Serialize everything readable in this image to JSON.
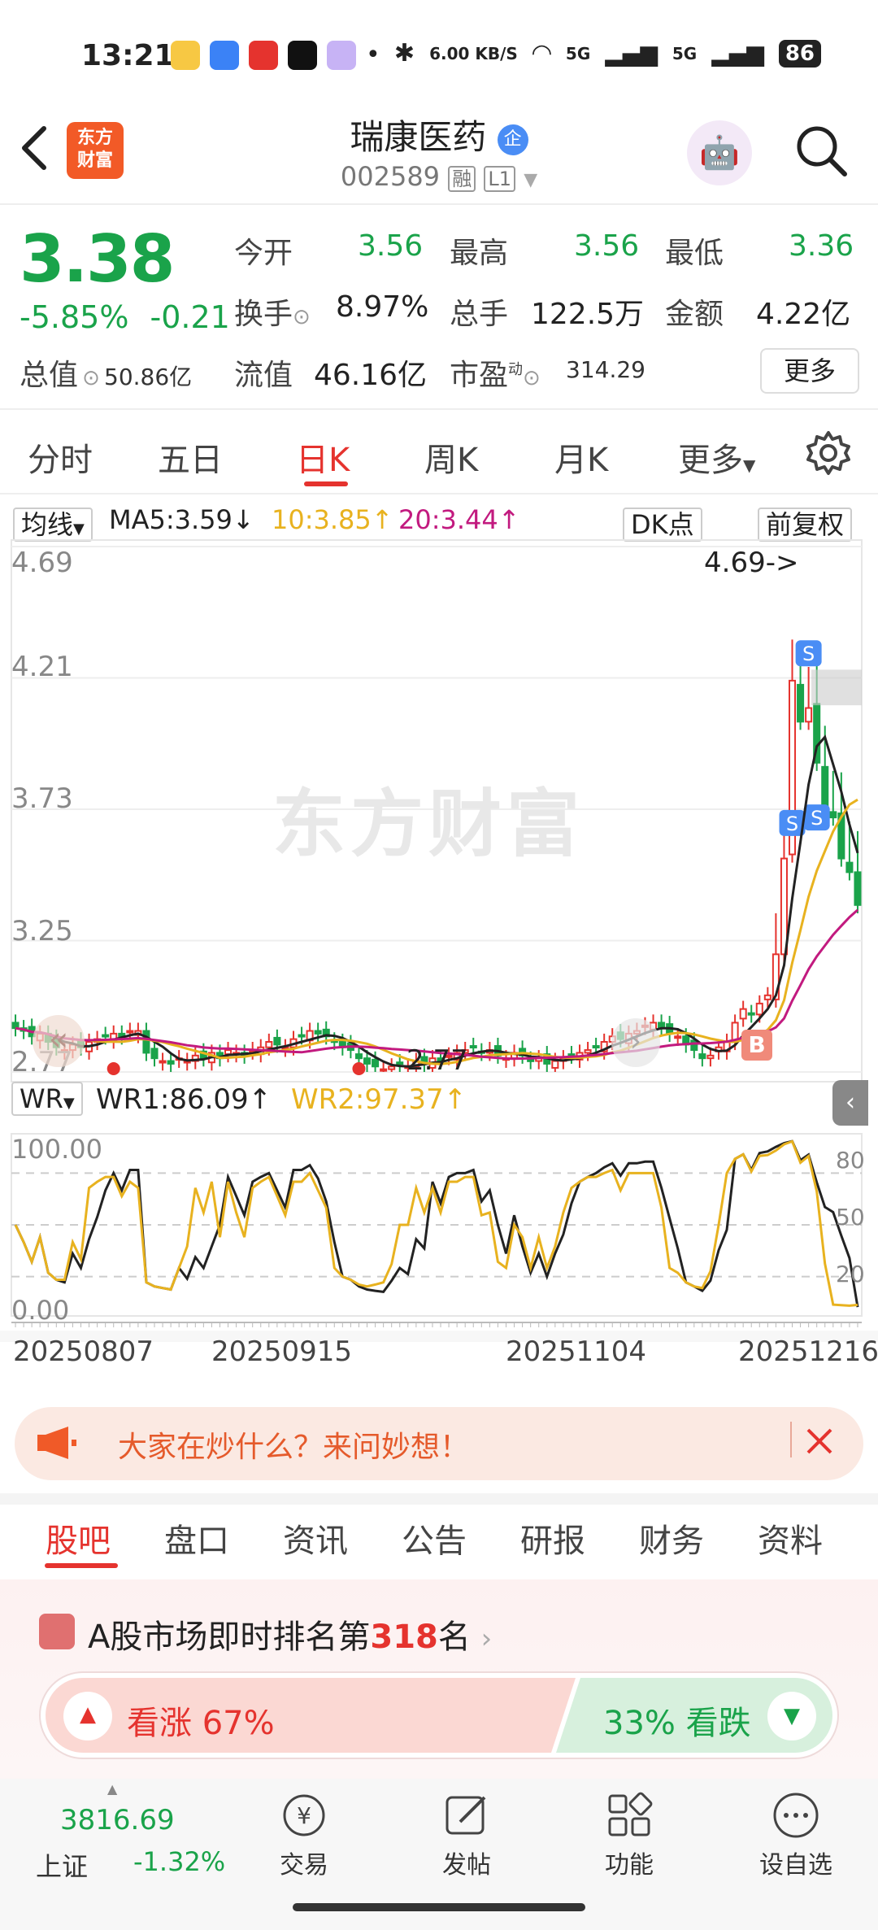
{
  "status_bar": {
    "time": "13:21",
    "speed": "6.00 KB/S",
    "battery": "86",
    "signal1": "5G",
    "signal2": "5G"
  },
  "header": {
    "logo_text_line1": "东方",
    "logo_text_line2": "财富",
    "stock_name": "瑞康医药",
    "stock_badge": "企",
    "stock_code": "002589",
    "tag_rong": "融",
    "tag_level": "L1"
  },
  "quote": {
    "price": "3.38",
    "change_pct": "-5.85%",
    "change_abs": "-0.21",
    "total_value_label": "总值",
    "total_value": "50.86亿",
    "open_label": "今开",
    "open": "3.56",
    "high_label": "最高",
    "high": "3.56",
    "low_label": "最低",
    "low": "3.36",
    "turnover_label": "换手",
    "turnover": "8.97%",
    "volume_label": "总手",
    "volume": "122.5万",
    "amount_label": "金额",
    "amount": "4.22亿",
    "float_label": "流值",
    "float_value": "46.16亿",
    "pe_label": "市盈",
    "pe_sup": "动",
    "pe": "314.29",
    "more_button": "更多"
  },
  "chart_tabs": [
    "分时",
    "五日",
    "日K",
    "周K",
    "月K",
    "更多"
  ],
  "active_chart_tab": "日K",
  "ma_row": {
    "selector": "均线",
    "ma5": "MA5:3.59",
    "ma10": "10:3.85",
    "ma20": "20:3.44",
    "dk": "DK点",
    "adjust": "前复权"
  },
  "kline": {
    "y_ticks": [
      "4.69",
      "4.21",
      "3.73",
      "3.25",
      "2.77"
    ],
    "max_label": "4.69->",
    "min_label": "2.77",
    "watermark": "东方财富",
    "b_badge": "B",
    "s_badge": "S"
  },
  "wr": {
    "selector": "WR",
    "wr1": "WR1:86.09",
    "wr2": "WR2:97.37",
    "y_left_top": "100.00",
    "y_left_bottom": "0.00",
    "y_right": [
      "80",
      "50",
      "20"
    ],
    "dates": [
      "20250807",
      "20250915",
      "20251104",
      "20251216"
    ]
  },
  "banner": {
    "text": "大家在炒什么？来问妙想！"
  },
  "sub_tabs": [
    "股吧",
    "盘口",
    "资讯",
    "公告",
    "研报",
    "财务",
    "资料"
  ],
  "rank": {
    "prefix": "A股市场即时排名第",
    "rank": "318",
    "suffix": "名",
    "bull_label": "看涨 67%",
    "bear_label": "33% 看跌"
  },
  "bottom_nav": {
    "index_value": "3816.69",
    "index_name": "上证",
    "index_change": "-1.32%",
    "items": [
      "交易",
      "发帖",
      "功能",
      "设自选"
    ]
  },
  "chart_data": {
    "type": "candlestick",
    "ylim": [
      2.77,
      4.69
    ],
    "y_ticks": [
      4.69,
      4.21,
      3.73,
      3.25,
      2.77
    ],
    "x_labels": [
      "20250807",
      "20250915",
      "20251104",
      "20251216"
    ],
    "closes": [
      2.93,
      2.92,
      2.9,
      2.91,
      2.88,
      2.86,
      2.85,
      2.87,
      2.86,
      2.88,
      2.89,
      2.9,
      2.91,
      2.9,
      2.92,
      2.92,
      2.84,
      2.82,
      2.81,
      2.8,
      2.82,
      2.81,
      2.83,
      2.82,
      2.84,
      2.82,
      2.85,
      2.84,
      2.83,
      2.85,
      2.86,
      2.88,
      2.87,
      2.86,
      2.89,
      2.9,
      2.92,
      2.91,
      2.9,
      2.88,
      2.86,
      2.85,
      2.82,
      2.8,
      2.79,
      2.78,
      2.79,
      2.8,
      2.79,
      2.81,
      2.8,
      2.82,
      2.81,
      2.83,
      2.84,
      2.85,
      2.86,
      2.84,
      2.85,
      2.83,
      2.82,
      2.84,
      2.83,
      2.81,
      2.82,
      2.8,
      2.81,
      2.82,
      2.83,
      2.84,
      2.85,
      2.86,
      2.88,
      2.9,
      2.89,
      2.91,
      2.92,
      2.94,
      2.95,
      2.93,
      2.91,
      2.9,
      2.87,
      2.85,
      2.82,
      2.83,
      2.86,
      2.88,
      2.95,
      3.0,
      2.98,
      3.02,
      3.05,
      3.2,
      3.55,
      4.2,
      4.05,
      4.1,
      3.9,
      3.72,
      3.7,
      3.55,
      3.5,
      3.38
    ],
    "ma5_last": 3.59,
    "ma10_last": 3.85,
    "ma20_last": 3.44
  }
}
